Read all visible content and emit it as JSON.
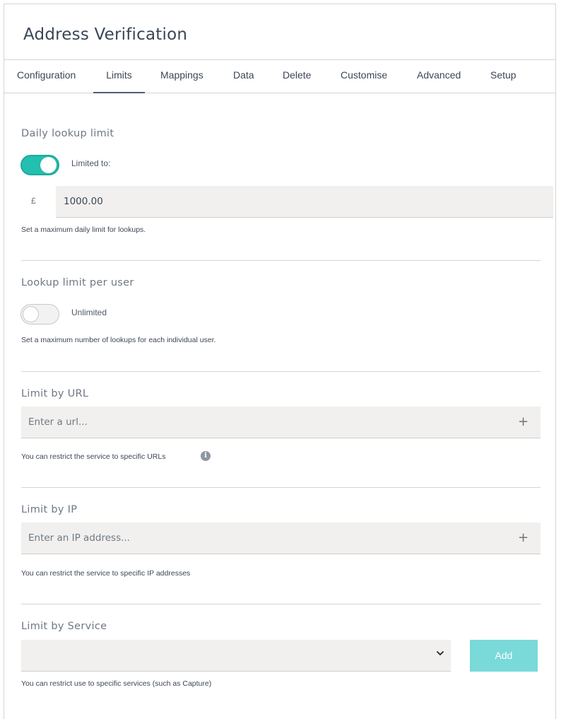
{
  "header": {
    "title": "Address Verification"
  },
  "tabs": [
    {
      "label": "Configuration"
    },
    {
      "label": "Limits"
    },
    {
      "label": "Mappings"
    },
    {
      "label": "Data"
    },
    {
      "label": "Delete"
    },
    {
      "label": "Customise"
    },
    {
      "label": "Advanced"
    },
    {
      "label": "Setup"
    }
  ],
  "active_tab": "Limits",
  "daily_limit": {
    "title": "Daily lookup limit",
    "toggle_on": true,
    "toggle_label": "Limited to:",
    "currency_symbol": "£",
    "amount": "1000.00",
    "help": "Set a maximum daily limit for lookups."
  },
  "user_limit": {
    "title": "Lookup limit per user",
    "toggle_on": false,
    "toggle_label": "Unlimited",
    "help": "Set a maximum number of lookups for each individual user."
  },
  "url_limit": {
    "title": "Limit by URL",
    "placeholder": "Enter a url...",
    "add_icon": "+",
    "help": "You can restrict the service to specific URLs",
    "info_icon": "i"
  },
  "ip_limit": {
    "title": "Limit by IP",
    "placeholder": "Enter an IP address...",
    "add_icon": "+",
    "help": "You can restrict the service to specific IP addresses"
  },
  "service_limit": {
    "title": "Limit by Service",
    "selected": "",
    "add_label": "Add",
    "help": "You can restrict use to specific services (such as Capture)"
  },
  "colors": {
    "accent": "#23bfb0",
    "add_button": "#7ad9d9",
    "tab_indicator": "#4a6078"
  }
}
